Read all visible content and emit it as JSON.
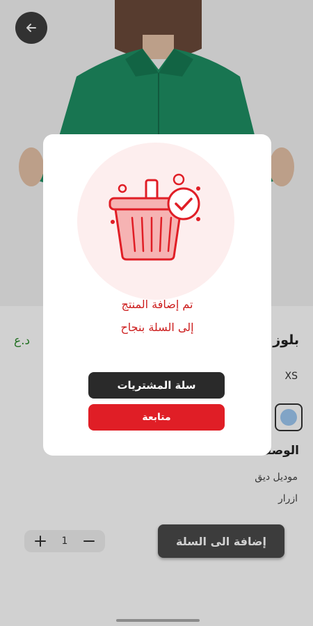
{
  "product": {
    "title": "بلوز",
    "price": "د.ع",
    "size": "XS",
    "description_title": "الوصف",
    "description_lines": [
      "موديل ديق",
      "ازرار"
    ],
    "quantity": "1",
    "add_to_cart_label": "إضافة الى السلة",
    "swatch_color": "#9ec9f2"
  },
  "dialog": {
    "message_line1": "تم إضافة المنتج",
    "message_line2": "إلى السلة بنجاح",
    "cart_button_label": "سلة المشتريات",
    "continue_button_label": "متابعة",
    "icon": "basket-check-icon",
    "accent_color": "#e01e26"
  },
  "icons": {
    "back": "arrow-left-icon",
    "plus": "plus-icon",
    "minus": "minus-icon"
  }
}
